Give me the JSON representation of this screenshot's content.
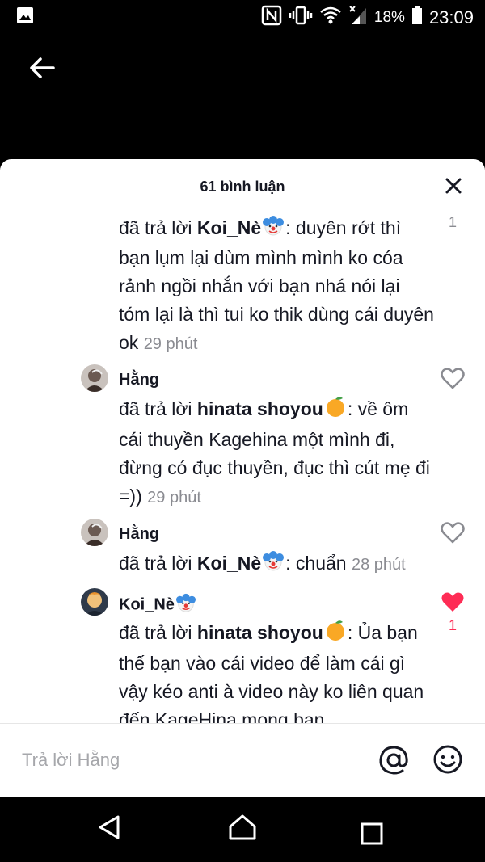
{
  "status": {
    "battery": "18%",
    "time": "23:09"
  },
  "sheet": {
    "title": "61 bình luận"
  },
  "comments": [
    {
      "reply_prefix": "đã trả lời ",
      "reply_to": "Koi_Nè",
      "text": ": duyên rớt thì bạn lụm lại dùm mình mình ko cóa rảnh ngồi nhắn với bạn nhá nói lại tóm lại là thì tui ko thik dùng cái duyên ok",
      "time": "29 phút",
      "likes": "1"
    },
    {
      "author": "Hằng",
      "reply_prefix": "đã trả lời ",
      "reply_to": "hinata shoyou",
      "text": ": về ôm cái thuyền Kagehina một mình đi, đừng có đục thuyền, đục thì cút mẹ đi =))",
      "time": "29 phút"
    },
    {
      "author": "Hằng",
      "reply_prefix": "đã trả lời ",
      "reply_to": "Koi_Nè",
      "text": ": chuẩn",
      "time": "28 phút"
    },
    {
      "author": "Koi_Nè",
      "reply_prefix": "đã trả lời ",
      "reply_to": "hinata shoyou",
      "text": ": Ủa bạn thế bạn vào cái video để làm cái gì vậy kéo anti à video này ko liên quan đến KageHina mong bạn",
      "likes": "1"
    }
  ],
  "input": {
    "placeholder": "Trả lời Hằng"
  },
  "colors": {
    "like_active": "#fe2c55",
    "text": "#161823",
    "muted": "#8a8b91"
  }
}
